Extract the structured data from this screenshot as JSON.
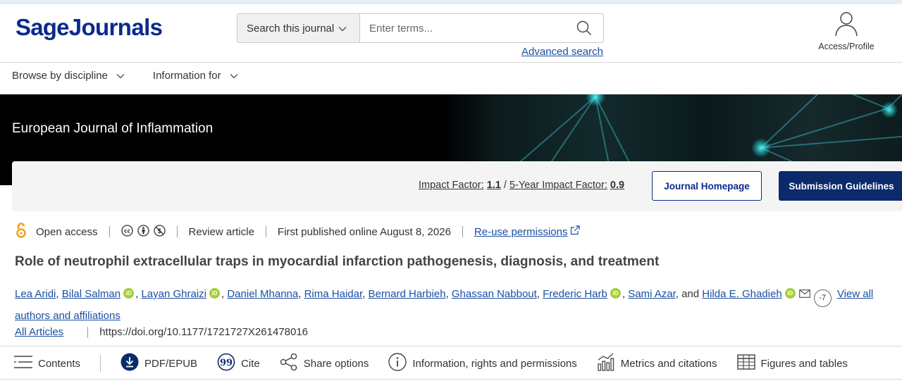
{
  "header": {
    "logo": {
      "part1": "Sage",
      "part2": "Journals"
    },
    "search": {
      "scope_label": "Search this journal",
      "placeholder": "Enter terms...",
      "advanced_label": "Advanced search"
    },
    "profile_label": "Access/Profile"
  },
  "nav": {
    "items": [
      {
        "label": "Browse by discipline"
      },
      {
        "label": "Information for"
      }
    ]
  },
  "banner": {
    "journal_title": "European Journal of Inflammation"
  },
  "infobar": {
    "impact_label": "Impact Factor:",
    "impact_value": "1.1",
    "divider": "/",
    "five_year_label": "5-Year Impact Factor:",
    "five_year_value": "0.9",
    "homepage_button": "Journal Homepage",
    "guidelines_button": "Submission Guidelines"
  },
  "meta": {
    "access": "Open access",
    "article_type": "Review article",
    "published": "First published online August 8, 2026",
    "reuse": "Re-use permissions"
  },
  "article": {
    "title": "Role of neutrophil extracellular traps in myocardial infarction pathogenesis, diagnosis, and treatment",
    "authors": [
      "Lea Aridi",
      "Bilal Salman",
      "Layan Ghraizi",
      "Daniel Mhanna",
      "Rima Haidar",
      "Bernard Harbieh",
      "Ghassan Nabbout",
      "Frederic Harb",
      "Sami Azar",
      "Hilda E. Ghadieh"
    ],
    "and_text": "and",
    "more_count": "-7",
    "view_all": "View all authors and affiliations",
    "all_articles": "All Articles",
    "doi": "https://doi.org/10.1177/1721727X261478016"
  },
  "toolbar": {
    "contents": "Contents",
    "pdf": "PDF/EPUB",
    "cite": "Cite",
    "share": "Share options",
    "info": "Information, rights and permissions",
    "metrics": "Metrics and citations",
    "figures": "Figures and tables"
  },
  "colors": {
    "brand": "#0b2a8c",
    "link": "#1a4fa3",
    "orcid": "#a6ce39",
    "open_access": "#f4a21a"
  }
}
